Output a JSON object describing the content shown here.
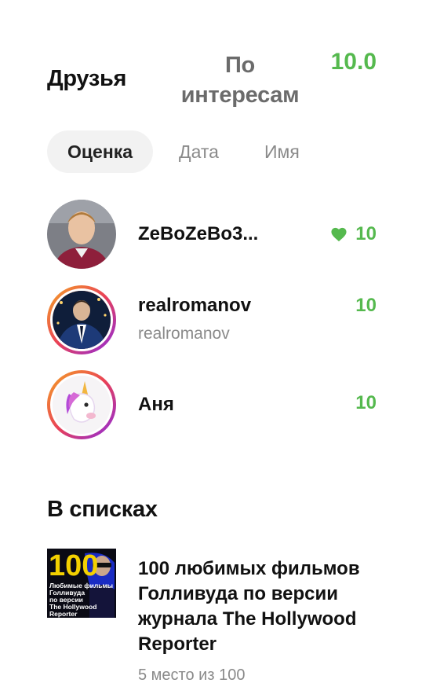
{
  "header": {
    "tab_friends": "Друзья",
    "tab_interests_line1": "По",
    "tab_interests_line2": "интересам",
    "score": "10.0"
  },
  "sort": {
    "rating": "Оценка",
    "date": "Дата",
    "name": "Имя",
    "active": "rating"
  },
  "friends": [
    {
      "name": "ZeBoZeBo3...",
      "handle": "",
      "score": "10",
      "liked": true,
      "icon": "heart-icon"
    },
    {
      "name": "realromanov",
      "handle": "realromanov",
      "score": "10",
      "liked": false
    },
    {
      "name": "Аня",
      "handle": "",
      "score": "10",
      "liked": false,
      "avatar_icon": "unicorn-icon"
    }
  ],
  "lists_section": {
    "title": "В списках",
    "items": [
      {
        "title": "100 любимых фильмов Голливуда по версии журнала The Hollywood Reporter",
        "meta": "5 место из 100",
        "cover": {
          "big_number": "100",
          "line1": "Любимые фильмы",
          "line2": "Голливуда",
          "line3": "по версии",
          "line4": "The Hollywood",
          "line5": "Reporter"
        }
      }
    ]
  },
  "colors": {
    "accent_green": "#55b94e",
    "muted_text": "#8a8a8a",
    "pill_bg": "#f2f2f2"
  }
}
